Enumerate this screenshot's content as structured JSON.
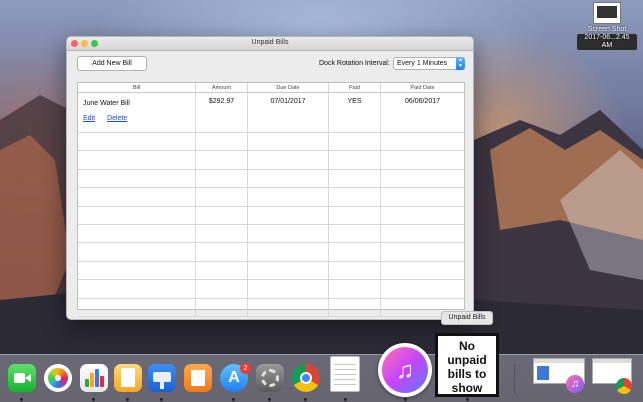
{
  "desktop": {
    "icon_label_line1": "Screen Shot",
    "icon_label_line2": "2017-06...2.45 AM"
  },
  "window": {
    "title": "Unpaid Bills",
    "add_button_label": "Add New Bill",
    "rotation_label": "Dock Rotation Interval:",
    "rotation_value": "Every 1 Minutes"
  },
  "table": {
    "columns": [
      "Bill",
      "Amount",
      "Due Date",
      "Paid",
      "Paid Date"
    ],
    "rows": [
      {
        "bill": "June Water Bill",
        "amount": "$292.97",
        "due_date": "07/01/2017",
        "paid": "YES",
        "paid_date": "06/06/2017",
        "edit_label": "Edit",
        "delete_label": "Delete"
      }
    ]
  },
  "dock": {
    "tooltip": "Unpaid Bills",
    "status_tile_text": "No unpaid bills to show",
    "app_store_badge": "2",
    "apps": [
      "facetime-icon",
      "photos-icon",
      "numbers-icon",
      "pages-icon",
      "keynote-icon",
      "ibooks-icon",
      "app-store-icon",
      "system-preferences-icon",
      "chrome-icon",
      "textedit-icon",
      "itunes-icon"
    ]
  }
}
